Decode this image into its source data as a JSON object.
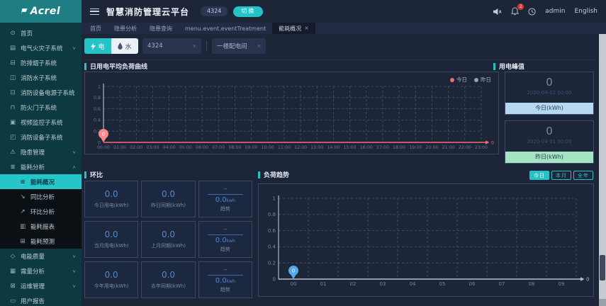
{
  "app": {
    "logo_text": "Acrel",
    "title": "智慧消防管理云平台",
    "project_badge": "4324",
    "switch_label": "切换",
    "notification_count": "2",
    "username": "admin",
    "language": "English"
  },
  "icons": {
    "chevron_down": "∨",
    "chevron_up": "∧",
    "close": "×",
    "select_arrow": "∨",
    "glyphs": {
      "home": "⊙",
      "elec-fire": "▤",
      "smoke-control": "⊟",
      "fire-water": "◫",
      "fire-power": "⊡",
      "fire-door": "⊓",
      "video-monitor": "▣",
      "fire-device": "◰",
      "hazard-mgmt": "⚠",
      "energy-analysis": "≣",
      "energy-overview": "≡",
      "yoy-analysis": "↘",
      "mom-analysis": "↗",
      "energy-report": "▥",
      "energy-forecast": "⊞",
      "power-quality": "◇",
      "demand-analysis": "▦",
      "ops-mgmt": "⊠",
      "user-report": "▭"
    }
  },
  "sidebar": {
    "items": [
      {
        "id": "home",
        "icon": "home",
        "label": "首页"
      },
      {
        "id": "elec-fire",
        "icon": "elec-fire",
        "label": "电气火灾子系统",
        "chevron": "down"
      },
      {
        "id": "smoke-control",
        "icon": "smoke-control",
        "label": "防排烟子系统"
      },
      {
        "id": "fire-water",
        "icon": "fire-water",
        "label": "消防水子系统"
      },
      {
        "id": "fire-power",
        "icon": "fire-power",
        "label": "消防设备电源子系统"
      },
      {
        "id": "fire-door",
        "icon": "fire-door",
        "label": "防火门子系统"
      },
      {
        "id": "video-monitor",
        "icon": "video-monitor",
        "label": "视频监控子系统"
      },
      {
        "id": "fire-device",
        "icon": "fire-device",
        "label": "消防设备子系统"
      },
      {
        "id": "hazard-mgmt",
        "icon": "hazard-mgmt",
        "label": "隐患管理",
        "chevron": "down"
      },
      {
        "id": "energy-analysis",
        "icon": "energy-analysis",
        "label": "能耗分析",
        "chevron": "up",
        "children": [
          {
            "id": "energy-overview",
            "icon": "energy-overview",
            "label": "能耗概况",
            "active": true
          },
          {
            "id": "yoy-analysis",
            "icon": "yoy-analysis",
            "label": "同比分析"
          },
          {
            "id": "mom-analysis",
            "icon": "mom-analysis",
            "label": "环比分析"
          },
          {
            "id": "energy-report",
            "icon": "energy-report",
            "label": "能耗报表"
          },
          {
            "id": "energy-forecast",
            "icon": "energy-forecast",
            "label": "能耗预测"
          }
        ]
      },
      {
        "id": "power-quality",
        "icon": "power-quality",
        "label": "电能质量",
        "chevron": "down"
      },
      {
        "id": "demand-analysis",
        "icon": "demand-analysis",
        "label": "需量分析",
        "chevron": "down"
      },
      {
        "id": "ops-mgmt",
        "icon": "ops-mgmt",
        "label": "运维管理",
        "chevron": "down"
      },
      {
        "id": "user-report",
        "icon": "user-report",
        "label": "用户报告"
      }
    ]
  },
  "tabs": [
    {
      "id": "home",
      "label": "首页"
    },
    {
      "id": "hazard-analysis",
      "label": "隐患分析"
    },
    {
      "id": "hazard-query",
      "label": "隐患查询"
    },
    {
      "id": "event-treatment",
      "label": "menu.event.eventTreatment"
    },
    {
      "id": "energy-overview",
      "label": "能耗概况",
      "active": true,
      "closable": true
    }
  ],
  "filters": {
    "electric_label": "电",
    "water_label": "水",
    "station_value": "4324",
    "room_value": "一楼配电间"
  },
  "sections": {
    "daily_curve": "日用电平均负荷曲线",
    "peak": "用电峰值",
    "huanbi": "环比",
    "load_trend": "负荷趋势"
  },
  "peak_cards": [
    {
      "value": "0",
      "time": "2020-04-02 00:00",
      "label": "今日(kWh)",
      "band_color": "#b7d8f3"
    },
    {
      "value": "0",
      "time": "2020-04-01 00:00",
      "label": "昨日(kWh)",
      "band_color": "#a4e4c5"
    }
  ],
  "huanbi": {
    "rows": [
      [
        {
          "value": "0.0",
          "label": "今日用电(kWh)"
        },
        {
          "value": "0.0",
          "label": "昨日同期(kWh)"
        },
        {
          "top": "--",
          "value": "0.0",
          "unit": "kwh",
          "label": "趋势"
        }
      ],
      [
        {
          "value": "0.0",
          "label": "当月用电(kWh)"
        },
        {
          "value": "0.0",
          "label": "上月同期(kWh)"
        },
        {
          "top": "--",
          "value": "0.0",
          "unit": "kwh",
          "label": "趋势"
        }
      ],
      [
        {
          "value": "0.0",
          "label": "今年用电(kWh)"
        },
        {
          "value": "0.0",
          "label": "去年同期(kWh)"
        },
        {
          "top": "--",
          "value": "0.0",
          "unit": "kwh",
          "label": "趋势"
        }
      ]
    ]
  },
  "trend_buttons": [
    {
      "id": "today",
      "label": "今日",
      "active": true
    },
    {
      "id": "month",
      "label": "本月"
    },
    {
      "id": "year",
      "label": "全年"
    }
  ],
  "colors": {
    "accent": "#25c3c5",
    "danger": "#f56c6c",
    "info_blue": "#5488c7",
    "pin_blue": "#57a8ea",
    "sidebar_bg": "#0d3a42",
    "main_bg": "#1d2539"
  },
  "chart_data": [
    {
      "id": "daily-load",
      "type": "line",
      "title": "日用电平均负荷曲线",
      "legend_position": "top-right",
      "grid": "dashed",
      "x": [
        "00:00",
        "01:00",
        "02:00",
        "03:00",
        "04:00",
        "05:00",
        "06:00",
        "07:00",
        "08:00",
        "09:00",
        "10:00",
        "11:00",
        "12:00",
        "13:00",
        "14:00",
        "15:00",
        "16:00",
        "17:00",
        "18:00",
        "19:00",
        "20:00",
        "21:00",
        "22:00",
        "23:00"
      ],
      "y_ticks": [
        0,
        0.2,
        0.4,
        0.6,
        0.8,
        1
      ],
      "ylim": [
        0,
        1
      ],
      "series": [
        {
          "name": "今日",
          "color": "#f56c6c",
          "values": [
            0,
            0,
            0,
            0,
            0,
            0,
            0,
            0,
            0,
            0,
            0,
            0,
            0,
            0,
            0,
            0,
            0,
            0,
            0,
            0,
            0,
            0,
            0,
            0
          ]
        },
        {
          "name": "昨日",
          "color": "#9aa0ab",
          "values": []
        }
      ],
      "marker": {
        "x": "00:00",
        "value": "0",
        "color": "#f78989"
      },
      "axis_line_color": "#f56c6c",
      "axis_end_label": "0"
    },
    {
      "id": "load-trend",
      "type": "line",
      "title": "负荷趋势",
      "grid": "dashed",
      "x": [
        "00",
        "01",
        "02",
        "03",
        "04",
        "05",
        "06",
        "07",
        "08",
        "09"
      ],
      "y_ticks": [
        0,
        0.2,
        0.4,
        0.6,
        0.8,
        1
      ],
      "ylim": [
        0,
        1
      ],
      "series": [
        {
          "name": "今日",
          "color": "#57a8ea",
          "values": [
            0
          ]
        }
      ],
      "marker": {
        "x": "00",
        "value": "0",
        "color": "#57a8ea"
      },
      "axis_line_color": "#b9bfca",
      "axis_end_label": "0"
    }
  ]
}
